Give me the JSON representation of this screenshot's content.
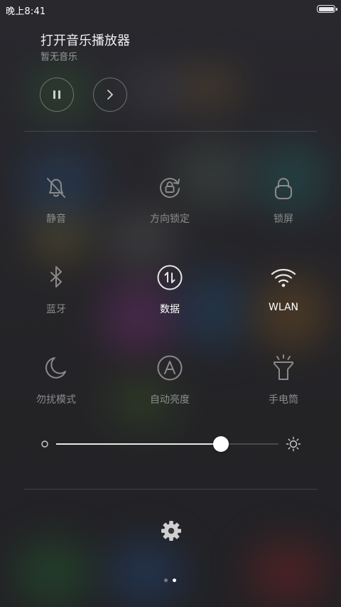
{
  "status_bar": {
    "time": "晚上8:41"
  },
  "music": {
    "title": "打开音乐播放器",
    "subtitle": "暂无音乐"
  },
  "toggles": [
    {
      "label": "静音",
      "icon": "bell-off-icon",
      "active": false
    },
    {
      "label": "方向锁定",
      "icon": "rotation-lock-icon",
      "active": false
    },
    {
      "label": "锁屏",
      "icon": "lock-icon",
      "active": false
    },
    {
      "label": "蓝牙",
      "icon": "bluetooth-icon",
      "active": false
    },
    {
      "label": "数据",
      "icon": "mobile-data-icon",
      "active": true
    },
    {
      "label": "WLAN",
      "icon": "wifi-icon",
      "active": true
    },
    {
      "label": "勿扰模式",
      "icon": "moon-icon",
      "active": false
    },
    {
      "label": "自动亮度",
      "icon": "auto-brightness-icon",
      "active": false
    },
    {
      "label": "手电筒",
      "icon": "flashlight-icon",
      "active": false
    }
  ],
  "brightness": {
    "level": 0.74
  },
  "pager": {
    "pages": 2,
    "current": 2
  },
  "colors": {
    "active_label": "#ffffff",
    "inactive_label": "#8c8c8c",
    "active_icon": "#e6e6e6",
    "inactive_icon": "#8a8a8a"
  }
}
